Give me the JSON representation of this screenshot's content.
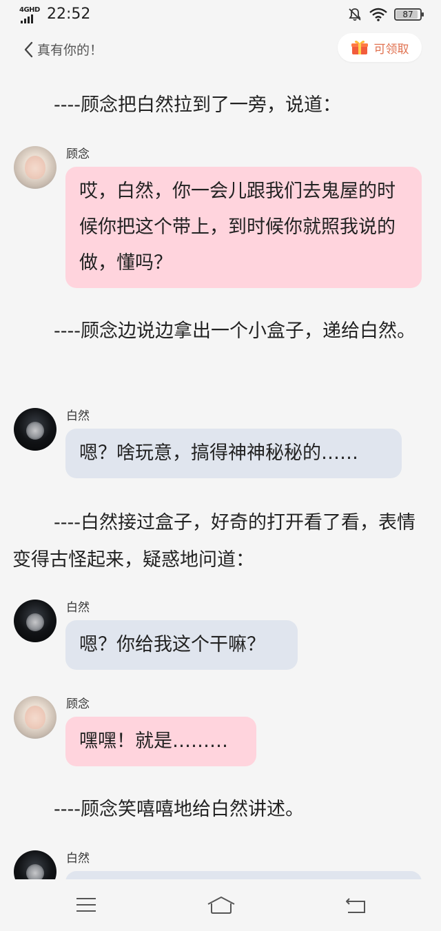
{
  "status_bar": {
    "network_label": "4GHD",
    "time": "22:52",
    "battery": "87"
  },
  "header": {
    "back_label": "真有你的！",
    "claim_label": "可领取"
  },
  "story": {
    "narration_1": "----顾念把白然拉到了一旁，说道：",
    "message_1": {
      "speaker": "顾念",
      "text": "哎，白然，你一会儿跟我们去鬼屋的时候你把这个带上，到时候你就照我说的做，懂吗？"
    },
    "narration_2": "----顾念边说边拿出一个小盒子，递给白然。",
    "message_2": {
      "speaker": "白然",
      "text": "嗯？啥玩意，搞得神神秘秘的……"
    },
    "narration_3": "----白然接过盒子，好奇的打开看了看，表情变得古怪起来，疑惑地问道：",
    "message_3": {
      "speaker": "白然",
      "text": "嗯？你给我这个干嘛？"
    },
    "message_4": {
      "speaker": "顾念",
      "text": "嘿嘿！就是………"
    },
    "narration_4": "----顾念笑嘻嘻地给白然讲述。",
    "message_5": {
      "speaker": "白然",
      "text": ""
    }
  },
  "icons": {
    "back": "chevron-left-icon",
    "claim": "gift-icon",
    "menu": "menu-icon",
    "home": "home-icon",
    "return": "return-icon",
    "mute": "bell-off-icon",
    "wifi": "wifi-icon"
  },
  "colors": {
    "page_bg": "#f5f5f5",
    "guyan_bubble": "#ffd4dd",
    "bairan_bubble": "#e0e5ee",
    "claim_accent": "#e0714f"
  }
}
